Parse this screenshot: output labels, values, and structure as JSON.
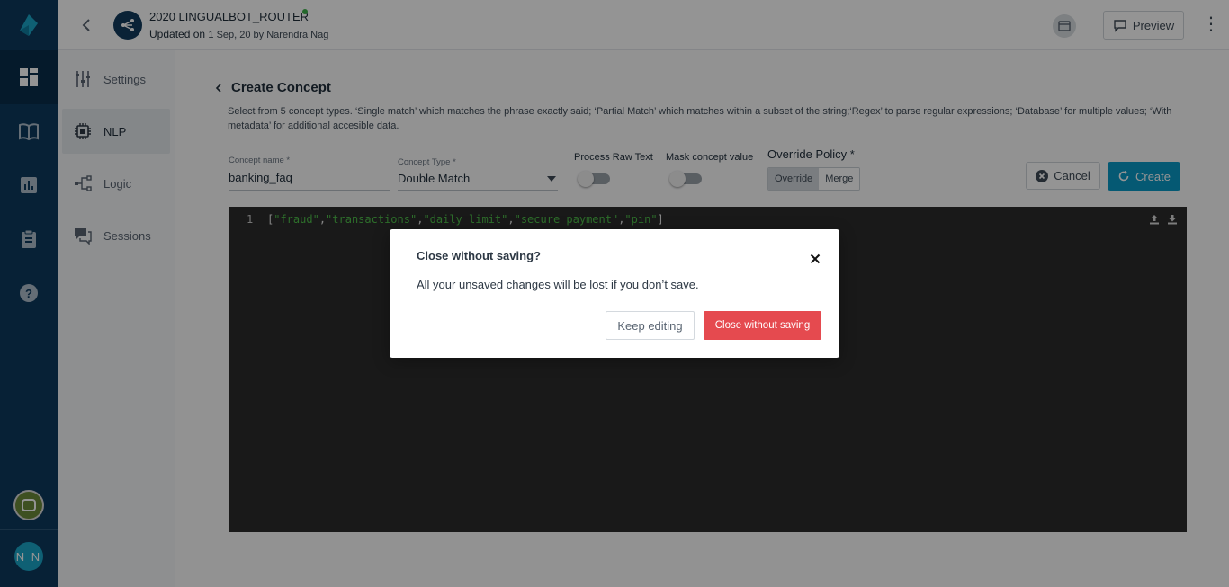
{
  "bot": {
    "name": "2020 LINGUALBOT_ROUTER",
    "updated_prefix": "Updated on",
    "updated_detail": "1 Sep, 20 by Narendra Nag",
    "status_color": "#3fb24a"
  },
  "topbar": {
    "preview_label": "Preview"
  },
  "rail": {
    "icons": [
      "dashboard-icon",
      "book-icon",
      "analytics-icon",
      "clipboard-icon",
      "help-icon"
    ],
    "user_initials": "N N"
  },
  "subnav": {
    "items": [
      {
        "label": "Settings",
        "icon": "sliders-icon"
      },
      {
        "label": "NLP",
        "icon": "chip-icon",
        "active": true
      },
      {
        "label": "Logic",
        "icon": "branch-icon"
      },
      {
        "label": "Sessions",
        "icon": "chat-icon"
      }
    ]
  },
  "page": {
    "title": "Create Concept",
    "description": "Select from 5 concept types. ‘Single match’ which matches the phrase exactly said; ‘Partial Match’ which matches within a subset of the string;‘Regex’ to parse regular expressions; ‘Database’ for multiple values; ‘With metadata’ for additional accesible data."
  },
  "form": {
    "concept_name_label": "Concept name *",
    "concept_name_value": "banking_faq",
    "concept_type_label": "Concept Type *",
    "concept_type_value": "Double Match",
    "process_raw_label": "Process Raw Text",
    "process_raw_on": false,
    "mask_label": "Mask concept value",
    "mask_on": false,
    "override_label": "Override Policy *",
    "override_options": [
      "Override",
      "Merge"
    ],
    "override_selected": "Override",
    "cancel_label": "Cancel",
    "create_label": "Create"
  },
  "editor": {
    "line_number": "1",
    "code_open": "[",
    "code_tokens": [
      "\"fraud\"",
      "\"transactions\"",
      "\"daily limit\"",
      "\"secure payment\"",
      "\"pin\""
    ],
    "code_sep": ",",
    "code_close": "]"
  },
  "dialog": {
    "title": "Close without saving?",
    "message": "All your unsaved changes will be lost if you don’t save.",
    "keep_label": "Keep editing",
    "discard_label": "Close without saving",
    "discard_color": "#e54a4f"
  },
  "colors": {
    "rail": "#0d3a5e",
    "accent": "#0a99c6"
  }
}
